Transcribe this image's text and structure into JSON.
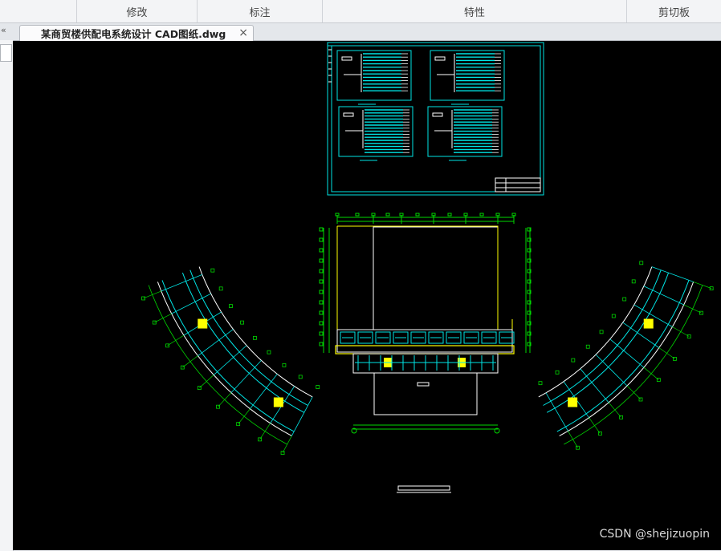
{
  "ribbon": {
    "groups": [
      {
        "label": ""
      },
      {
        "label": "修改"
      },
      {
        "label": "标注"
      },
      {
        "label": "特性"
      },
      {
        "label": "剪切板"
      }
    ]
  },
  "document_tab": {
    "title": "某商贸楼供配电系统设计 CAD图纸.dwg",
    "close_glyph": "×"
  },
  "left_collapse_glyph": "«",
  "watermark": "CSDN @shejizuopin",
  "drawing_colors": {
    "background": "#000000",
    "cyan": "#00e5e5",
    "green": "#00d800",
    "yellow": "#ffff00",
    "white": "#ffffff"
  }
}
